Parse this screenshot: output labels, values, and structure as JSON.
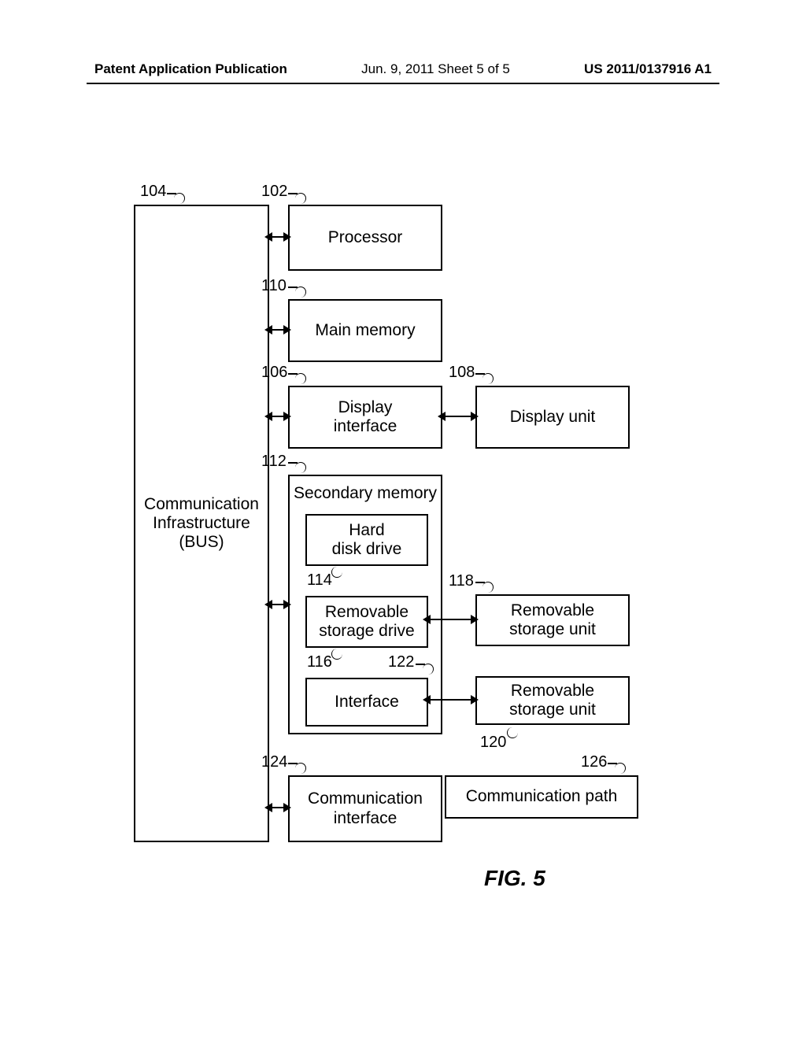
{
  "header": {
    "left": "Patent Application Publication",
    "center": "Jun. 9, 2011  Sheet 5 of 5",
    "right": "US 2011/0137916 A1"
  },
  "figure_label": "FIG. 5",
  "refs": {
    "r104": "104",
    "r102": "102",
    "r110": "110",
    "r106": "106",
    "r108": "108",
    "r112": "112",
    "r114": "114",
    "r118": "118",
    "r116": "116",
    "r122": "122",
    "r120": "120",
    "r124": "124",
    "r126": "126"
  },
  "boxes": {
    "bus_l1": "Communication",
    "bus_l2": "Infrastructure",
    "bus_l3": "(BUS)",
    "processor": "Processor",
    "main_memory": "Main memory",
    "display_interface_l1": "Display",
    "display_interface_l2": "interface",
    "display_unit": "Display unit",
    "secondary_memory": "Secondary memory",
    "hard_disk_l1": "Hard",
    "hard_disk_l2": "disk drive",
    "removable_drive_l1": "Removable",
    "removable_drive_l2": "storage drive",
    "interface": "Interface",
    "removable_unit_l1": "Removable",
    "removable_unit_l2": "storage unit",
    "comm_interface_l1": "Communication",
    "comm_interface_l2": "interface",
    "comm_path": "Communication path"
  }
}
